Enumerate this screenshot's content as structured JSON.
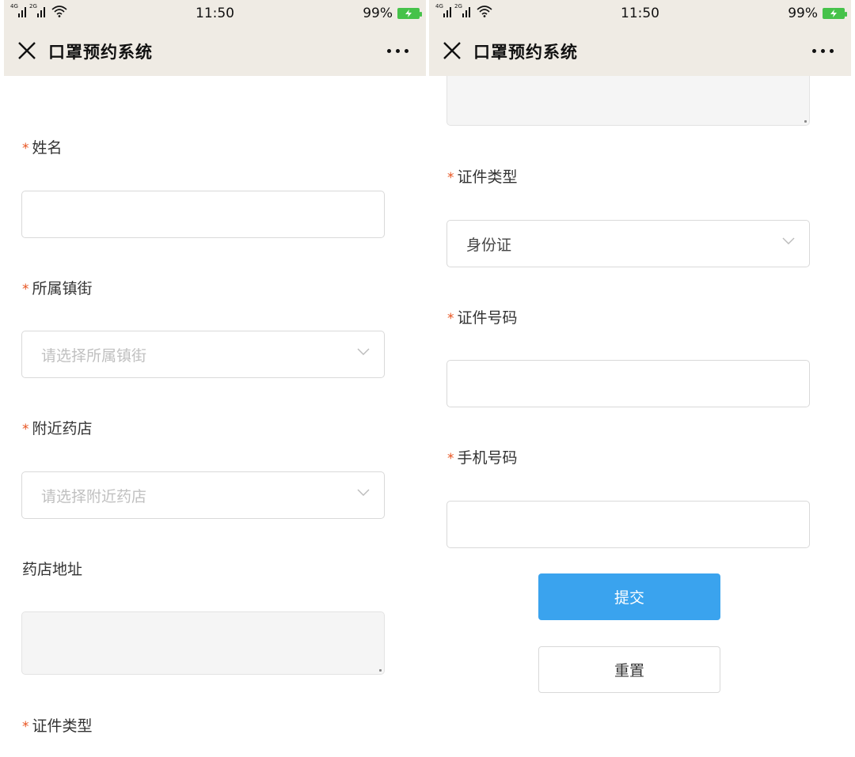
{
  "status_bar": {
    "network_1": "4G",
    "network_2": "2G",
    "time": "11:50",
    "battery": "99%",
    "battery_color": "#46c24a"
  },
  "nav": {
    "title": "口罩预约系统",
    "close_icon": "close-icon",
    "more_icon": "more-horizontal-icon"
  },
  "colors": {
    "nav_background": "#efebe4",
    "required_mark": "#e8531f",
    "primary_button": "#3aa3ee"
  },
  "form": {
    "required_mark": "*",
    "name_label": "姓名",
    "name_value": "",
    "town_label": "所属镇街",
    "town_placeholder": "请选择所属镇街",
    "pharmacy_label": "附近药店",
    "pharmacy_placeholder": "请选择附近药店",
    "address_label": "药店地址",
    "address_value": "",
    "id_type_label": "证件类型",
    "id_type_value": "身份证",
    "id_number_label": "证件号码",
    "id_number_value": "",
    "phone_label": "手机号码",
    "phone_value": "",
    "submit_label": "提交",
    "reset_label": "重置"
  }
}
